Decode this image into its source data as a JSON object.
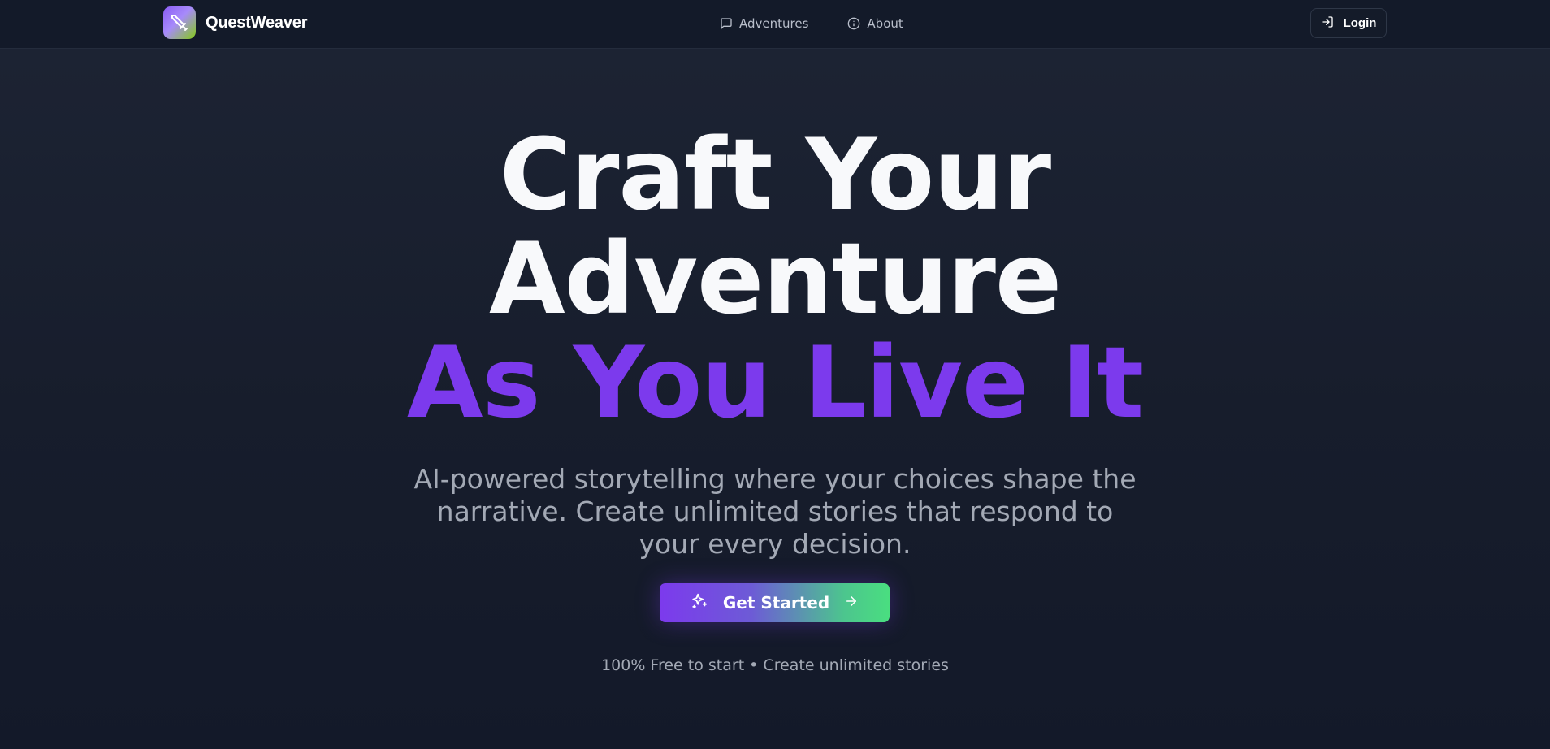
{
  "nav": {
    "brand": "QuestWeaver",
    "links": [
      {
        "label": "Adventures",
        "icon": "chat-bubble-icon"
      },
      {
        "label": "About",
        "icon": "info-circle-icon"
      }
    ],
    "login_label": "Login",
    "login_icon": "login-arrow-icon",
    "logo_icon": "sword-icon"
  },
  "hero": {
    "headline_line1": "Craft Your",
    "headline_line2": "Adventure",
    "headline_line3": "As You Live It",
    "subtitle": "AI-powered storytelling where your choices shape the narrative. Create unlimited stories that respond to your every decision.",
    "cta_label": "Get Started",
    "cta_icons": [
      "sparkles-icon",
      "arrow-right-icon"
    ],
    "footnote": "100% Free to start • Create unlimited stories"
  },
  "colors": {
    "accent_purple": "#7c3aed",
    "accent_green": "#4ade80",
    "background": "#171d2c",
    "muted_text": "#a3a9b5"
  }
}
